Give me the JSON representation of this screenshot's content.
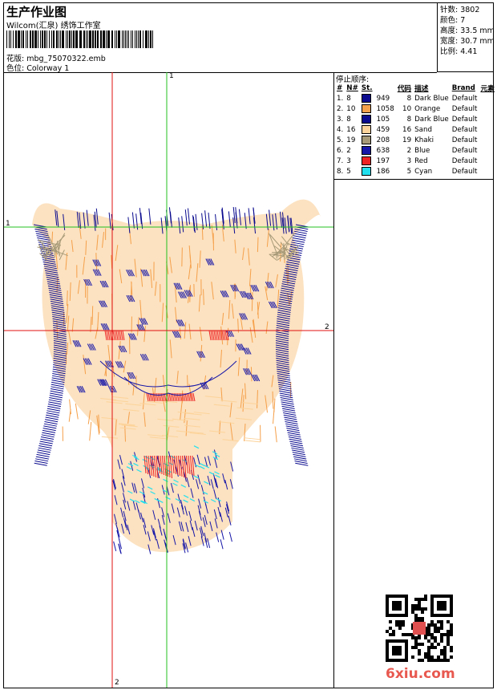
{
  "header": {
    "title": "生产作业图",
    "company": "Wilcom(汇泉) 绣饰工作室",
    "design_file_label": "花版:",
    "design_file": "mbg_75070322.emb",
    "colorway_label": "色位:",
    "colorway": "Colorway 1"
  },
  "stats": {
    "stitches": "针数: 3802",
    "colors": "颜色: 7",
    "height": "高度: 33.5 mm",
    "width": "宽度: 30.7 mm",
    "ratio": "比例: 4.41"
  },
  "stops": {
    "heading": "停止顺序:",
    "columns": [
      "#",
      "N#",
      "St.",
      "代码",
      "描述",
      "Brand",
      "元素"
    ],
    "rows": [
      {
        "idx": "1.",
        "n": "8",
        "color": "#0b0b8f",
        "st": "949",
        "code": "8",
        "desc": "Dark Blue",
        "brand": "Default"
      },
      {
        "idx": "2.",
        "n": "10",
        "color": "#f5a04a",
        "st": "1058",
        "code": "10",
        "desc": "Orange",
        "brand": "Default"
      },
      {
        "idx": "3.",
        "n": "8",
        "color": "#0b0b8f",
        "st": "105",
        "code": "8",
        "desc": "Dark Blue",
        "brand": "Default"
      },
      {
        "idx": "4.",
        "n": "16",
        "color": "#fcd39a",
        "st": "459",
        "code": "16",
        "desc": "Sand",
        "brand": "Default"
      },
      {
        "idx": "5.",
        "n": "19",
        "color": "#a79a78",
        "st": "208",
        "code": "19",
        "desc": "Khaki",
        "brand": "Default"
      },
      {
        "idx": "6.",
        "n": "2",
        "color": "#1616a8",
        "st": "638",
        "code": "2",
        "desc": "Blue",
        "brand": "Default"
      },
      {
        "idx": "7.",
        "n": "3",
        "color": "#ee2222",
        "st": "197",
        "code": "3",
        "desc": "Red",
        "brand": "Default"
      },
      {
        "idx": "8.",
        "n": "5",
        "color": "#22e0ee",
        "st": "186",
        "code": "5",
        "desc": "Cyan",
        "brand": "Default"
      }
    ]
  },
  "axes": {
    "v1": "1",
    "h1": "1",
    "h2": "2",
    "v2": "2"
  },
  "watermark": "6xiu.com"
}
